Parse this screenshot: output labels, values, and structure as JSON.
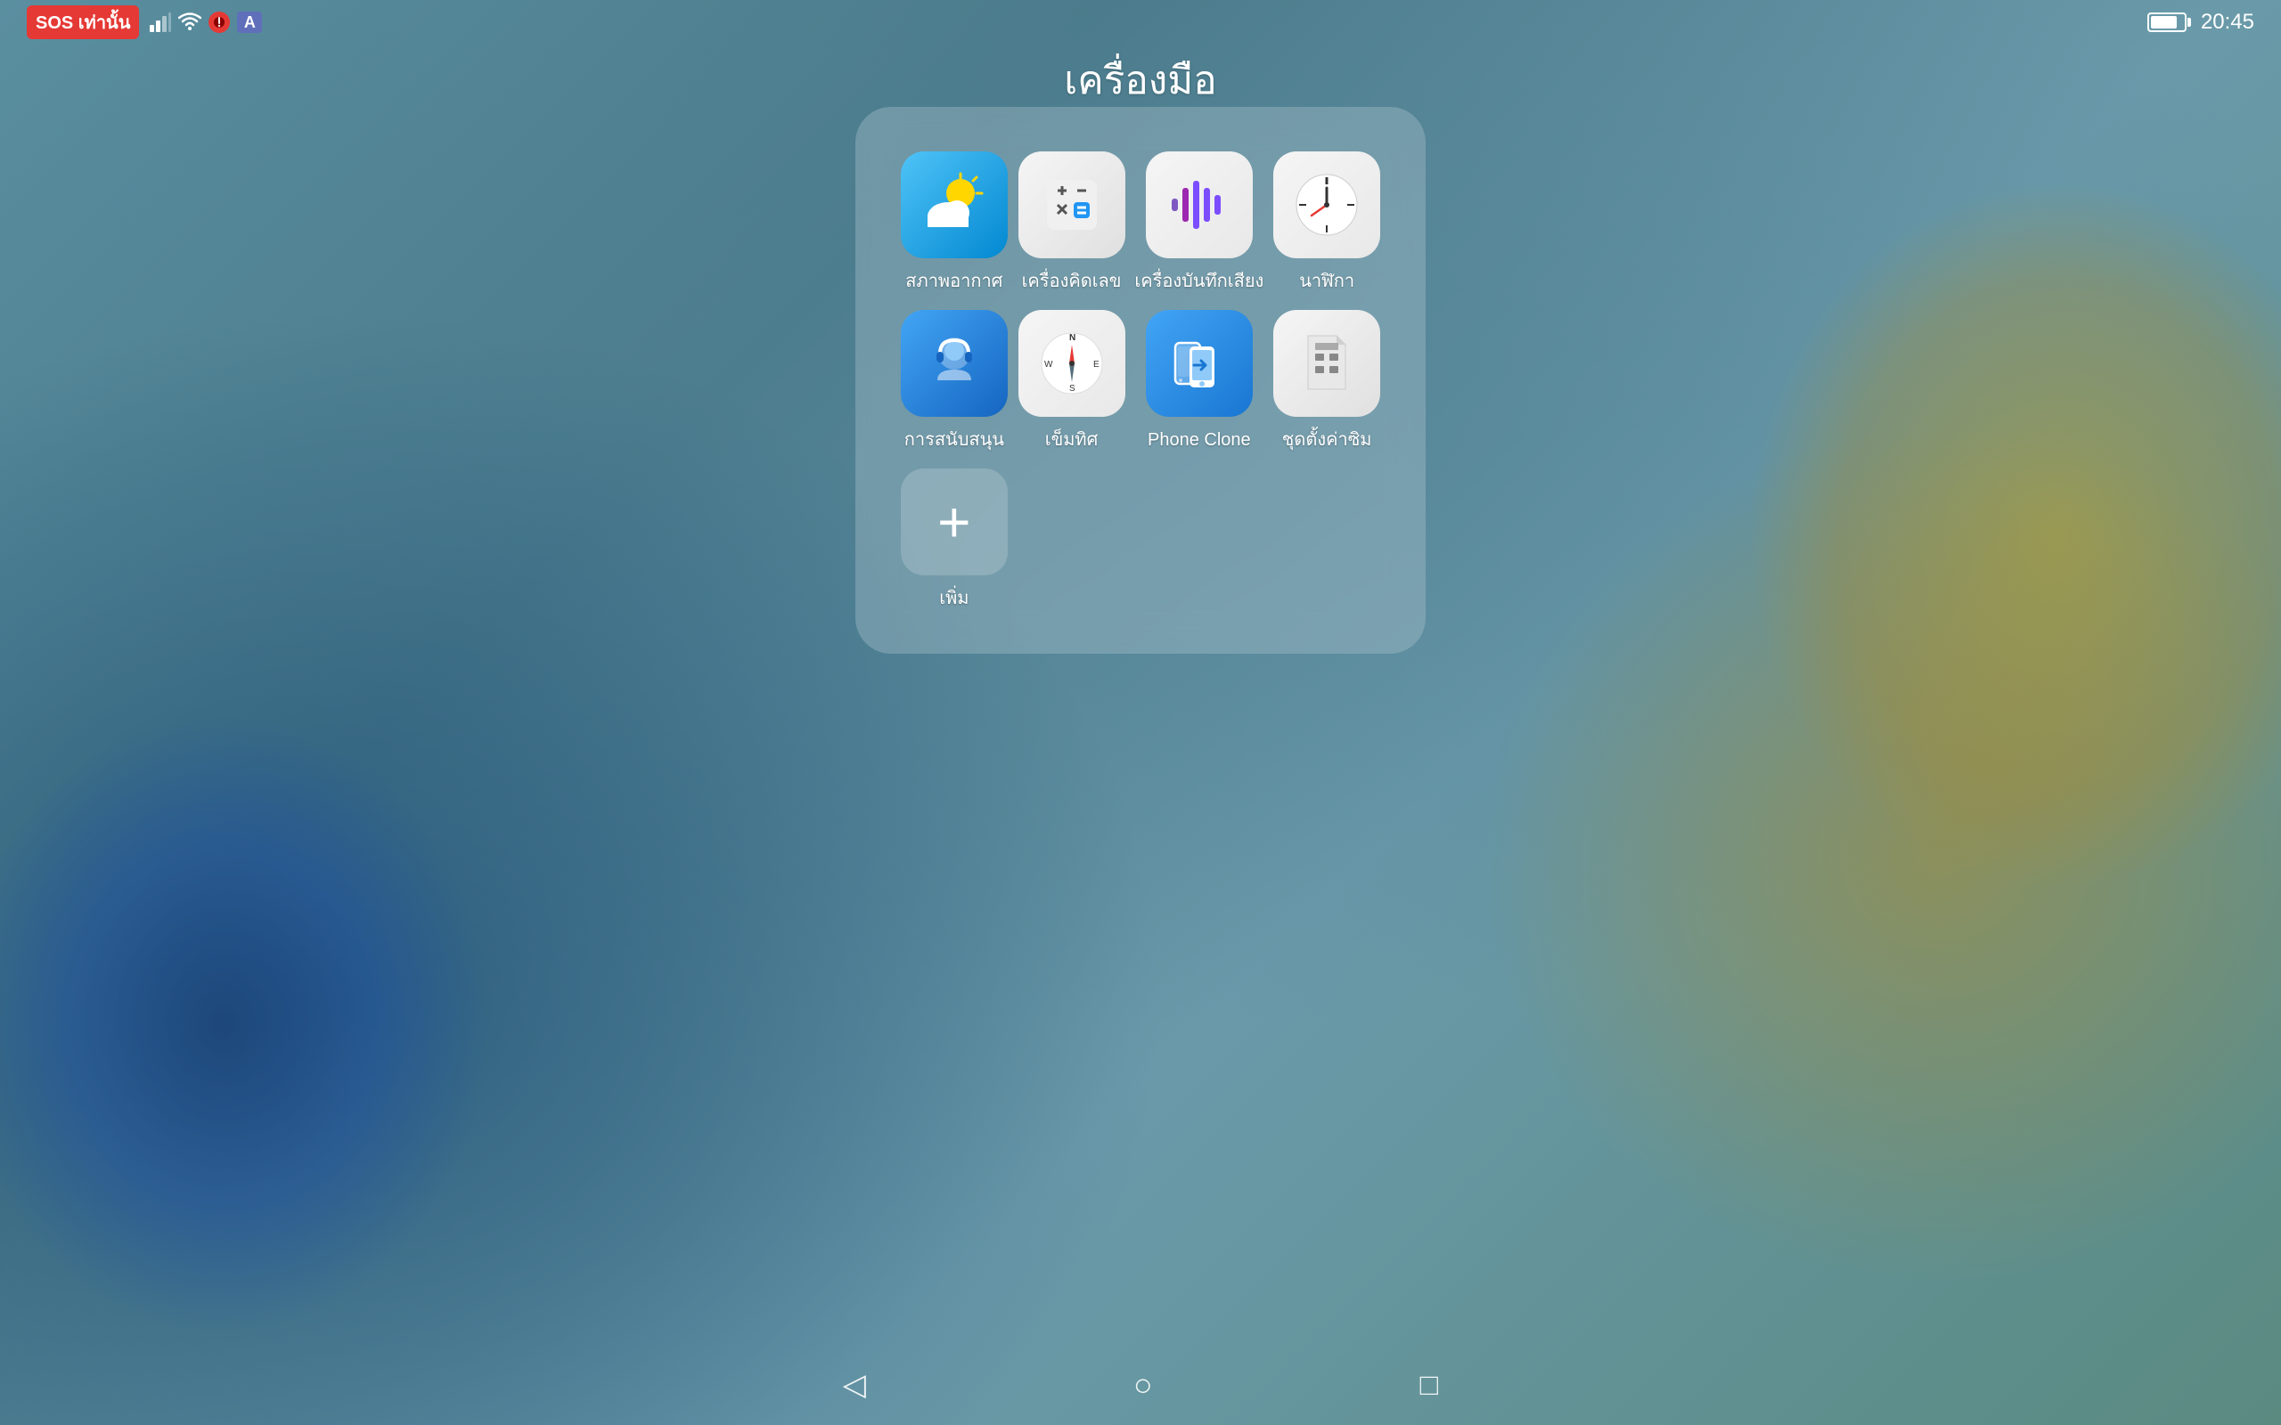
{
  "statusBar": {
    "sos": "SOS เท่านั้น",
    "time": "20:45",
    "batteryLevel": 80
  },
  "pageTitle": "เครื่องมือ",
  "apps": [
    {
      "id": "weather",
      "label": "สภาพอากาศ",
      "iconType": "weather"
    },
    {
      "id": "calculator",
      "label": "เครื่องคิดเลข",
      "iconType": "calculator"
    },
    {
      "id": "recorder",
      "label": "เครื่องบันทึกเสียง",
      "iconType": "recorder"
    },
    {
      "id": "clock",
      "label": "นาฬิกา",
      "iconType": "clock"
    },
    {
      "id": "support",
      "label": "การสนับสนุน",
      "iconType": "support"
    },
    {
      "id": "compass",
      "label": "เข็มทิศ",
      "iconType": "compass"
    },
    {
      "id": "phoneclone",
      "label": "Phone Clone",
      "iconType": "phoneclone"
    },
    {
      "id": "simtoolkit",
      "label": "ชุดตั้งค่าซิม",
      "iconType": "simtoolkit"
    },
    {
      "id": "add",
      "label": "เพิ่ม",
      "iconType": "add"
    }
  ],
  "navBar": {
    "back": "◁",
    "home": "○",
    "recent": "□"
  }
}
